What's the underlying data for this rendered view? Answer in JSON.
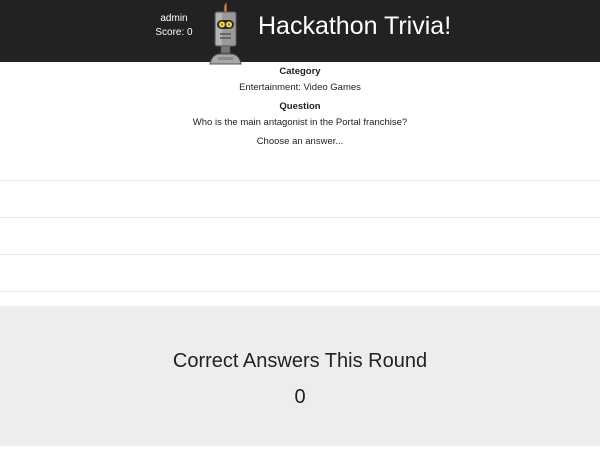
{
  "header": {
    "username": "admin",
    "score_text": "Score: 0",
    "title": "Hackathon Trivia!",
    "background": "#222222",
    "mascot_icon": "robot-icon"
  },
  "question": {
    "category_label": "Category",
    "category": "Entertainment: Video Games",
    "question_label": "Question",
    "text": "Who is the main antagonist in the Portal franchise?",
    "prompt": "Choose an answer..."
  },
  "answers": [
    "",
    "",
    ""
  ],
  "round": {
    "title": "Correct Answers This Round",
    "correct_count": "0",
    "panel_color": "#ededed"
  }
}
